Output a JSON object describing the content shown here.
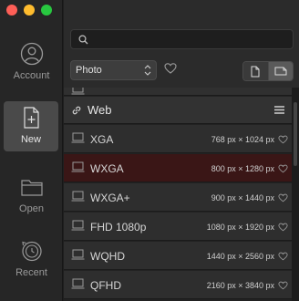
{
  "sidebar": {
    "items": [
      {
        "label": "Account",
        "icon": "account-icon"
      },
      {
        "label": "New",
        "icon": "new-document-icon",
        "active": true
      },
      {
        "label": "Open",
        "icon": "folder-icon"
      },
      {
        "label": "Recent",
        "icon": "recent-icon"
      }
    ]
  },
  "search": {
    "value": "",
    "placeholder": ""
  },
  "toolbar": {
    "category": "Photo",
    "category_options": [
      "Photo"
    ],
    "orientation_options": [
      "portrait",
      "landscape"
    ],
    "orientation_selected": "landscape"
  },
  "list": {
    "group": {
      "title": "Web",
      "icon": "link-icon"
    },
    "rows": [
      {
        "name": "XGA",
        "dims": "768 px × 1024 px",
        "selected": false
      },
      {
        "name": "WXGA",
        "dims": "800 px × 1280 px",
        "selected": true
      },
      {
        "name": "WXGA+",
        "dims": "900 px × 1440 px",
        "selected": false
      },
      {
        "name": "FHD 1080p",
        "dims": "1080 px × 1920 px",
        "selected": false
      },
      {
        "name": "WQHD",
        "dims": "1440 px × 2560 px",
        "selected": false
      },
      {
        "name": "QFHD",
        "dims": "2160 px × 3840 px",
        "selected": false
      }
    ]
  },
  "colors": {
    "accent_selected_row": "#3a1616",
    "traffic_red": "#fe5f57",
    "traffic_yellow": "#febc2e",
    "traffic_green": "#28c840"
  }
}
